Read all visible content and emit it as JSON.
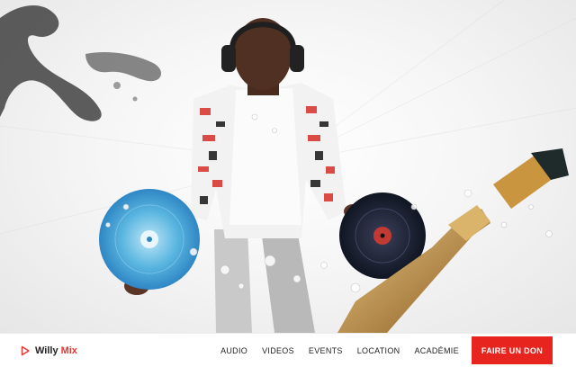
{
  "hero": {
    "image": "dj-artwork-headphones-vinyl-champagne"
  },
  "brand": {
    "name": "Willy",
    "accent": "Mix",
    "icon": "play-icon"
  },
  "nav": {
    "items": [
      {
        "label": "AUDIO"
      },
      {
        "label": "VIDEOS"
      },
      {
        "label": "EVENTS"
      },
      {
        "label": "LOCATION"
      },
      {
        "label": "ACADÉMIE"
      }
    ],
    "cta": "FAIRE UN DON"
  },
  "colors": {
    "accent": "#e8241f",
    "text": "#222222",
    "background": "#ffffff"
  }
}
